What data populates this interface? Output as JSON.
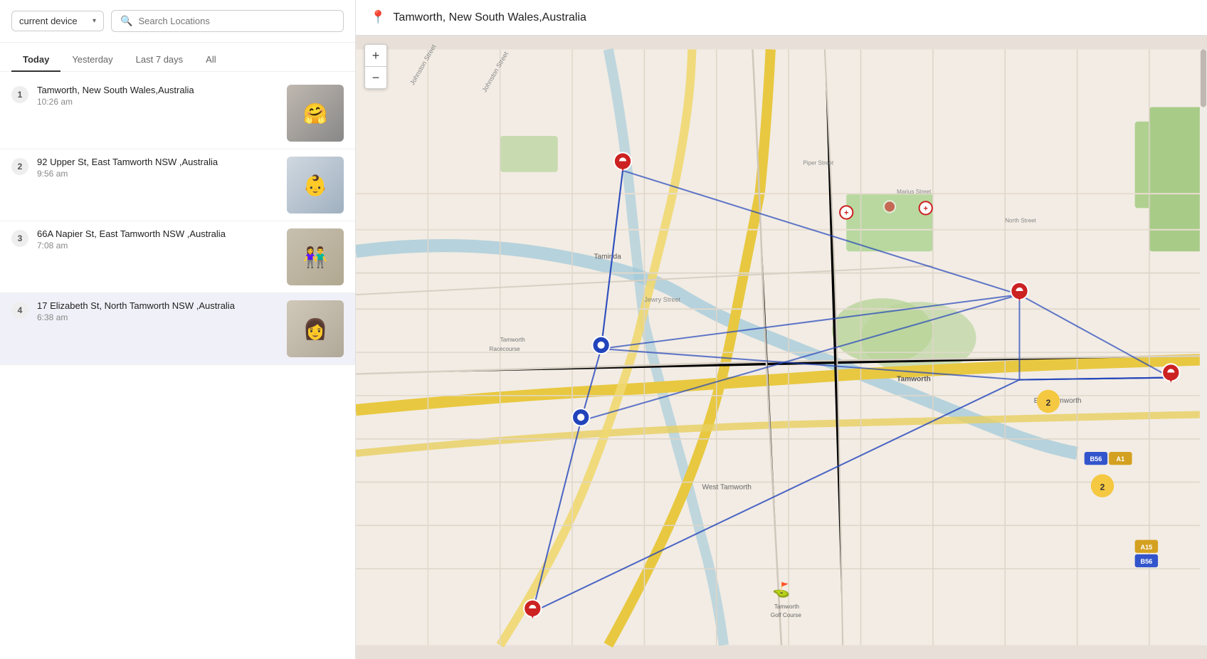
{
  "device_selector": {
    "label": "current device",
    "chevron": "▾"
  },
  "search": {
    "placeholder": "Search Locations"
  },
  "tabs": [
    {
      "id": "today",
      "label": "Today",
      "active": true
    },
    {
      "id": "yesterday",
      "label": "Yesterday",
      "active": false
    },
    {
      "id": "last7",
      "label": "Last 7 days",
      "active": false
    },
    {
      "id": "all",
      "label": "All",
      "active": false
    }
  ],
  "locations": [
    {
      "number": "1",
      "name": "Tamworth, New South Wales,Australia",
      "time": "10:26 am",
      "thumb_class": "thumb-bg-1",
      "thumb_emoji": "🤗",
      "active": false
    },
    {
      "number": "2",
      "name": "92 Upper St,  East Tamworth NSW ,Australia",
      "time": "9:56 am",
      "thumb_class": "thumb-bg-2",
      "thumb_emoji": "👶",
      "active": false
    },
    {
      "number": "3",
      "name": "66A Napier St,  East Tamworth NSW ,Australia",
      "time": "7:08 am",
      "thumb_class": "thumb-bg-3",
      "thumb_emoji": "👫",
      "active": false
    },
    {
      "number": "4",
      "name": "17 Elizabeth St,  North Tamworth NSW ,Australia",
      "time": "6:38 am",
      "thumb_class": "thumb-bg-4",
      "thumb_emoji": "👩",
      "active": true
    }
  ],
  "map": {
    "title": "Tamworth, New South Wales,Australia",
    "location_pin": "📍",
    "zoom_in": "+",
    "zoom_out": "−"
  }
}
